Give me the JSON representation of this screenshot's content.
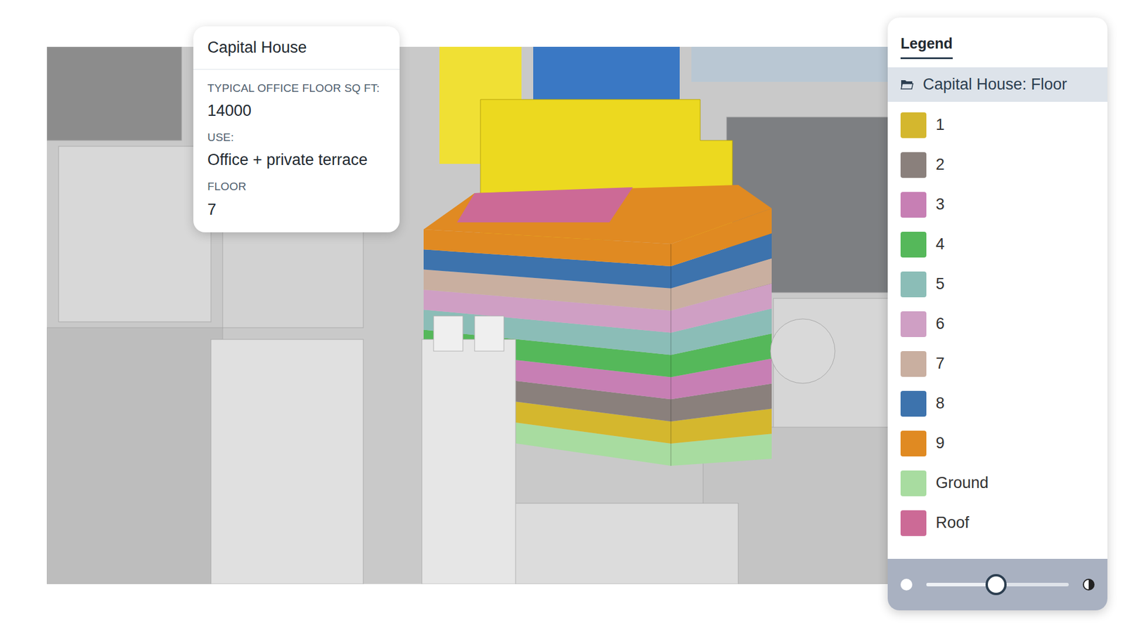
{
  "popup": {
    "title": "Capital House",
    "fields": [
      {
        "label": "TYPICAL OFFICE FLOOR SQ FT:",
        "value": "14000"
      },
      {
        "label": "USE:",
        "value": "Office + private terrace"
      },
      {
        "label": "FLOOR",
        "value": "7"
      }
    ]
  },
  "legend": {
    "title": "Legend",
    "layer": {
      "label": "Capital House: Floor",
      "selected": true
    },
    "items": [
      {
        "label": "1",
        "color": "#d4b72e",
        "kind": "floor"
      },
      {
        "label": "2",
        "color": "#8a807c",
        "kind": "floor"
      },
      {
        "label": "3",
        "color": "#c77fb4",
        "kind": "floor"
      },
      {
        "label": "4",
        "color": "#55b85a",
        "kind": "floor"
      },
      {
        "label": "5",
        "color": "#8bbdb7",
        "kind": "floor"
      },
      {
        "label": "6",
        "color": "#cf9fc4",
        "kind": "floor"
      },
      {
        "label": "7",
        "color": "#c9afa0",
        "kind": "floor"
      },
      {
        "label": "8",
        "color": "#3d73ad",
        "kind": "floor"
      },
      {
        "label": "9",
        "color": "#e08a22",
        "kind": "floor"
      },
      {
        "label": "Ground",
        "color": "#a8dca0",
        "kind": "ground"
      },
      {
        "label": "Roof",
        "color": "#cc6a96",
        "kind": "roof"
      }
    ],
    "opacity": {
      "level": 0.49
    }
  }
}
